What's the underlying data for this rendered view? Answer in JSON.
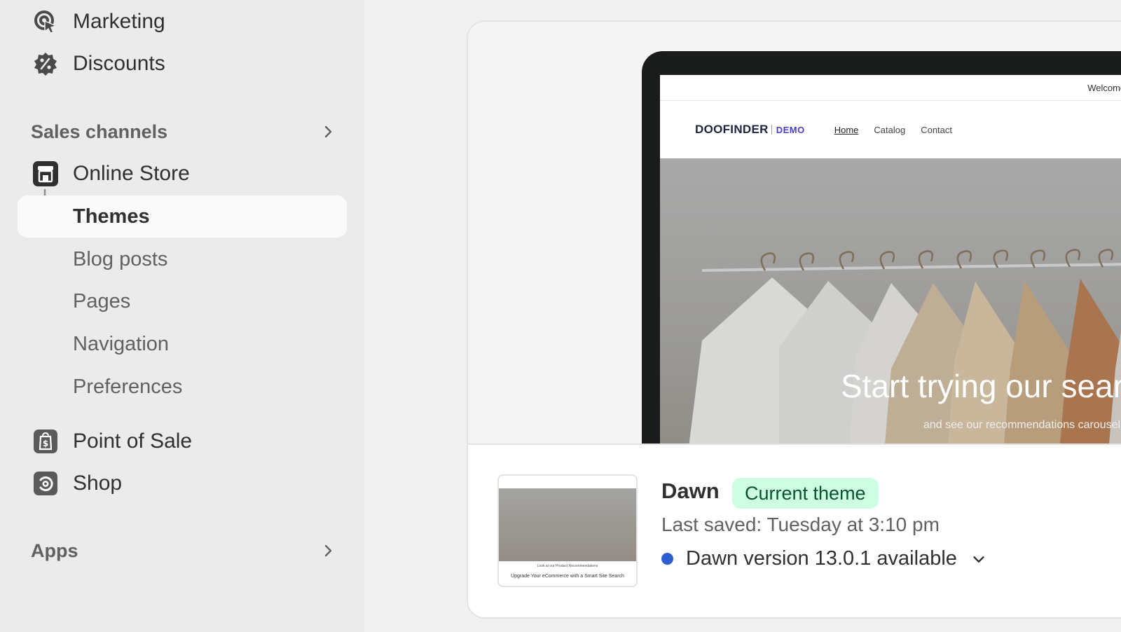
{
  "sidebar": {
    "marketing_label": "Marketing",
    "discounts_label": "Discounts",
    "sales_channels_label": "Sales channels",
    "online_store_label": "Online Store",
    "sub_items": [
      "Themes",
      "Blog posts",
      "Pages",
      "Navigation",
      "Preferences"
    ],
    "point_of_sale_label": "Point of Sale",
    "shop_label": "Shop",
    "apps_label": "Apps"
  },
  "preview": {
    "announcement": "Welcome to our Demo Store",
    "logo_text": "DOOFINDER",
    "logo_demo": "DEMO",
    "nav": [
      "Home",
      "Catalog",
      "Contact"
    ],
    "hero_title": "Start trying our search!",
    "hero_subtitle": "and see our recommendations carousel"
  },
  "thumbnail": {
    "line1": "Look at our Product Recommendations",
    "line2": "Upgrade Your eCommerce with a Smart Site Search"
  },
  "theme": {
    "name": "Dawn",
    "badge": "Current theme",
    "last_saved": "Last saved: Tuesday at 3:10 pm",
    "version_text": "Dawn version 13.0.1 available"
  },
  "colors": {
    "badge_bg": "#cdfee1",
    "badge_text": "#0c5132",
    "version_dot": "#2c5ecf",
    "sidebar_bg": "#ebebeb"
  }
}
